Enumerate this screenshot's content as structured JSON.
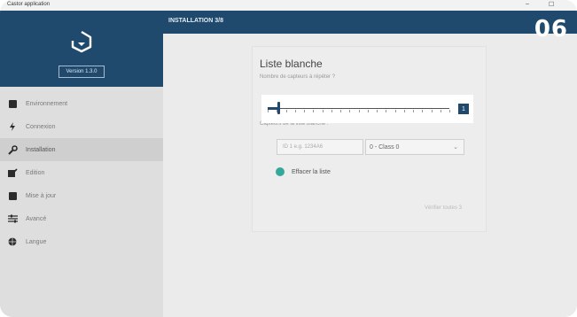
{
  "window": {
    "title": "Castor application",
    "minimize": "–",
    "maximize": "☐"
  },
  "sidebar": {
    "version": "Version 1.3.0",
    "items": [
      {
        "label": "Environnement",
        "icon": "box-icon"
      },
      {
        "label": "Connexion",
        "icon": "lightning-icon"
      },
      {
        "label": "Installation",
        "icon": "wrench-icon",
        "active": true
      },
      {
        "label": "Edition",
        "icon": "edit-icon"
      },
      {
        "label": "Mise à jour",
        "icon": "update-icon"
      },
      {
        "label": "Avancé",
        "icon": "sliders-icon"
      },
      {
        "label": "Langue",
        "icon": "globe-icon"
      }
    ]
  },
  "header": {
    "step": "INSTALLATION 3/8",
    "badge": "06"
  },
  "panel": {
    "title": "Liste blanche",
    "slider_label": "Nombre de capteurs à répéter ?",
    "slider_value": "1",
    "sensors_label": "Capteurs de la liste blanche :",
    "id_placeholder": "ID 1 e.g. 1234A6",
    "class_value": "0 - Class 0",
    "clear_label": "Effacer la liste",
    "next_label": "Vérifier toutes 3"
  },
  "colors": {
    "accent": "#1f4a6e",
    "teal": "#35a89c"
  }
}
